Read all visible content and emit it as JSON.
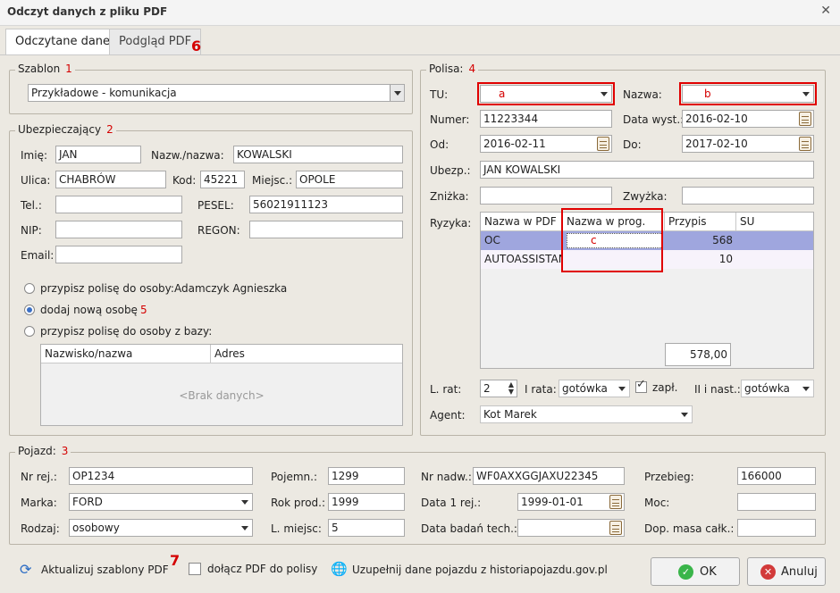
{
  "window": {
    "title": "Odczyt danych z pliku PDF",
    "close_glyph": "✕"
  },
  "tabs": [
    {
      "label": "Odczytane dane"
    },
    {
      "label": "Podgląd PDF"
    }
  ],
  "markers": {
    "m1": "1",
    "m2": "2",
    "m3": "3",
    "m4": "4",
    "m5": "5",
    "m6": "6",
    "m7": "7"
  },
  "szablon": {
    "legend": "Szablon",
    "value": "Przykładowe - komunikacja"
  },
  "ubezpieczajacy": {
    "legend": "Ubezpieczający",
    "imie_label": "Imię:",
    "imie": "JAN",
    "nazw_label": "Nazw./nazwa:",
    "nazw": "KOWALSKI",
    "ulica_label": "Ulica:",
    "ulica": "CHABRÓW",
    "kod_label": "Kod:",
    "kod": "45221",
    "miejsc_label": "Miejsc.:",
    "miejsc": "OPOLE",
    "tel_label": "Tel.:",
    "tel": "",
    "pesel_label": "PESEL:",
    "pesel": "56021911123",
    "nip_label": "NIP:",
    "nip": "",
    "regon_label": "REGON:",
    "regon": "",
    "email_label": "Email:",
    "email": "",
    "radio1": "przypisz polisę do osoby:",
    "radio1_person": "Adamczyk Agnieszka",
    "radio2": "dodaj nową osobę",
    "radio3": "przypisz polisę do osoby z bazy:",
    "grid_cols": [
      "Nazwisko/nazwa",
      "Adres"
    ],
    "grid_empty": "<Brak danych>"
  },
  "polisa": {
    "legend": "Polisa:",
    "tu_label": "TU:",
    "tu": "a",
    "nazwa_label": "Nazwa:",
    "nazwa": "b",
    "numer_label": "Numer:",
    "numer": "11223344",
    "data_wyst_label": "Data wyst.:",
    "data_wyst": "2016-02-10",
    "od_label": "Od:",
    "od": "2016-02-11",
    "do_label": "Do:",
    "do": "2017-02-10",
    "ubezp_label": "Ubezp.:",
    "ubezp": "JAN KOWALSKI",
    "znizka_label": "Zniżka:",
    "znizka": "",
    "zwyzka_label": "Zwyżka:",
    "zwyzka": "",
    "ryzyka_label": "Ryzyka:",
    "ryzyka_cols": [
      "Nazwa w PDF",
      "Nazwa w prog.",
      "Przypis",
      "SU"
    ],
    "ryzyka_rows": [
      {
        "pdf": "OC",
        "prog": "c",
        "przypis": "568",
        "su": ""
      },
      {
        "pdf": "AUTOASSISTANCE",
        "prog": "",
        "przypis": "10",
        "su": ""
      }
    ],
    "suma": "578,00",
    "l_rat_label": "L. rat:",
    "l_rat": "2",
    "i_rata_label": "I rata:",
    "i_rata": "gotówka",
    "zapl_label": "zapł.",
    "ii_rata_label": "II i nast.:",
    "ii_rata": "gotówka",
    "agent_label": "Agent:",
    "agent": "Kot Marek"
  },
  "pojazd": {
    "legend": "Pojazd:",
    "nr_rej_label": "Nr rej.:",
    "nr_rej": "OP1234",
    "marka_label": "Marka:",
    "marka": "FORD",
    "rodzaj_label": "Rodzaj:",
    "rodzaj": "osobowy",
    "pojemn_label": "Pojemn.:",
    "pojemn": "1299",
    "rok_label": "Rok prod.:",
    "rok": "1999",
    "l_miejsc_label": "L. miejsc:",
    "l_miejsc": "5",
    "nr_nadw_label": "Nr nadw.:",
    "nr_nadw": "WF0AXXGGJAXU22345",
    "data1_label": "Data 1 rej.:",
    "data1": "1999-01-01",
    "badan_label": "Data badań tech.:",
    "badan": "",
    "przebieg_label": "Przebieg:",
    "przebieg": "166000",
    "moc_label": "Moc:",
    "moc": "",
    "dop_label": "Dop. masa całk.:",
    "dop": ""
  },
  "footer": {
    "update_templates": "Aktualizuj szablony PDF",
    "attach_pdf": "dołącz PDF do polisy",
    "fill_vehicle": "Uzupełnij dane pojazdu z historiapojazdu.gov.pl",
    "ok": "OK",
    "cancel": "Anuluj"
  },
  "colors": {
    "accent_red": "#e00000",
    "selected_row": "#9fa6de",
    "ok_green": "#3ab54a",
    "cancel_red": "#d23a3a"
  }
}
